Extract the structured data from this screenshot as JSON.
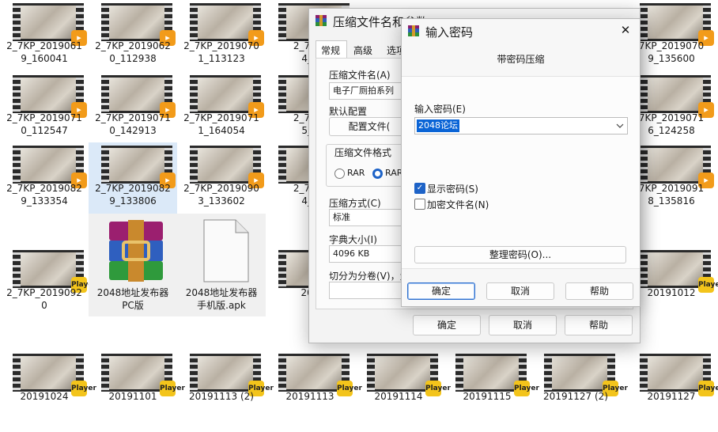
{
  "files": [
    {
      "id": "f1",
      "name": "2_7KP_2019061\n9_160041",
      "badge": "▸"
    },
    {
      "id": "f2",
      "name": "2_7KP_2019062\n0_112938",
      "badge": "▸"
    },
    {
      "id": "f3",
      "name": "2_7KP_2019070\n1_113123",
      "badge": "▸"
    },
    {
      "id": "f4",
      "name": "2_7KP_\n4_1",
      "badge": "▸"
    },
    {
      "id": "f5",
      "name": "7KP_2019070\n9_135600",
      "badge": "▸"
    },
    {
      "id": "f6",
      "name": "2_7KP_2019071\n0_112547",
      "badge": "▸"
    },
    {
      "id": "f7",
      "name": "2_7KP_2019071\n0_142913",
      "badge": "▸"
    },
    {
      "id": "f8",
      "name": "2_7KP_2019071\n1_164054",
      "badge": "▸"
    },
    {
      "id": "f9",
      "name": "2_7KP_\n5_1",
      "badge": "▸"
    },
    {
      "id": "f10",
      "name": "7KP_2019071\n6_124258",
      "badge": "▸"
    },
    {
      "id": "f11",
      "name": "2_7KP_2019082\n9_133354",
      "badge": "▸"
    },
    {
      "id": "f12",
      "name": "2_7KP_2019082\n9_133806",
      "badge": "▸"
    },
    {
      "id": "f13",
      "name": "2_7KP_2019090\n3_133602",
      "badge": "▸"
    },
    {
      "id": "f14",
      "name": "2_7KP_\n4_1",
      "badge": "▸"
    },
    {
      "id": "f15",
      "name": "7KP_2019091\n8_135816",
      "badge": "▸"
    },
    {
      "id": "f16",
      "name": "2_7KP_2019092\n0",
      "badge": "Player"
    },
    {
      "id": "f17",
      "name": "2048地址发布器\nPC版",
      "badge": ""
    },
    {
      "id": "f18",
      "name": "2048地址发布器\n手机版.apk",
      "badge": ""
    },
    {
      "id": "f19",
      "name": "201",
      "badge": "Player"
    },
    {
      "id": "f20",
      "name": "20191012",
      "badge": "Player"
    },
    {
      "id": "f21",
      "name": "20191024",
      "badge": "Player"
    },
    {
      "id": "f22",
      "name": "20191101",
      "badge": "Player"
    },
    {
      "id": "f23",
      "name": "20191113 (2)",
      "badge": "Player"
    },
    {
      "id": "f24",
      "name": "20191113",
      "badge": "Player"
    },
    {
      "id": "f25",
      "name": "20191114",
      "badge": "Player"
    },
    {
      "id": "f26",
      "name": "20191115",
      "badge": "Player"
    },
    {
      "id": "f27",
      "name": "20191127 (2)",
      "badge": "Player"
    },
    {
      "id": "f28",
      "name": "20191127",
      "badge": "Player"
    }
  ],
  "archive_dialog": {
    "title": "压缩文件名和参数",
    "tabs": [
      "常规",
      "高级",
      "选项"
    ],
    "archive_name_label": "压缩文件名(A)",
    "archive_name_value": "电子厂厕拍系列",
    "default_profile_label": "默认配置",
    "profile_button": "配置文件(",
    "format_group_label": "压缩文件格式",
    "format_rar": "RAR",
    "format_rar4": "RAR4",
    "method_label": "压缩方式(C)",
    "method_value": "标准",
    "dict_label": "字典大小(I)",
    "dict_value": "4096 KB",
    "split_label": "切分为分卷(V)，大",
    "ok": "确定",
    "cancel": "取消",
    "help": "帮助"
  },
  "password_dialog": {
    "title": "输入密码",
    "close": "✕",
    "subtitle": "带密码压缩",
    "password_label": "输入密码(E)",
    "password_value": "2048论坛",
    "show_password": "显示密码(S)",
    "encrypt_names": "加密文件名(N)",
    "organize_button": "整理密码(O)...",
    "ok": "确定",
    "cancel": "取消",
    "help": "帮助"
  }
}
